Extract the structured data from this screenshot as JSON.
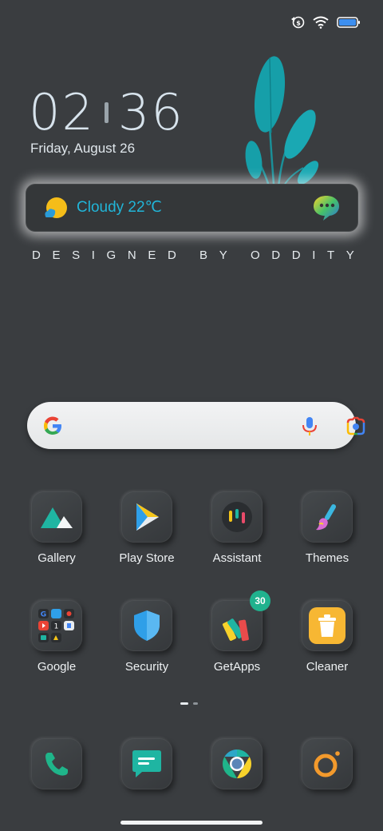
{
  "status": {
    "icons": [
      "data-saver-icon",
      "wifi-icon",
      "battery-icon"
    ]
  },
  "clock": {
    "hours": "02",
    "minutes": "36"
  },
  "date": "Friday, August 26",
  "weather": {
    "text": "Cloudy 22℃",
    "icon": "partly-cloudy-icon"
  },
  "tagline": [
    "D",
    "E",
    "S",
    "I",
    "G",
    "N",
    "E",
    "D",
    " ",
    "B",
    "Y",
    " ",
    "O",
    "D",
    "D",
    "I",
    "T",
    "Y"
  ],
  "search": {
    "icon": "google-g-icon",
    "mic_icon": "mic-icon",
    "lens_icon": "lens-icon"
  },
  "apps": [
    {
      "label": "Gallery",
      "icon": "gallery-icon"
    },
    {
      "label": "Play Store",
      "icon": "play-store-icon"
    },
    {
      "label": "Assistant",
      "icon": "assistant-icon"
    },
    {
      "label": "Themes",
      "icon": "themes-icon"
    },
    {
      "label": "Google",
      "icon": "google-folder-icon"
    },
    {
      "label": "Security",
      "icon": "security-icon"
    },
    {
      "label": "GetApps",
      "icon": "getapps-icon",
      "badge": "30"
    },
    {
      "label": "Cleaner",
      "icon": "cleaner-icon"
    }
  ],
  "dock": [
    {
      "icon": "phone-icon"
    },
    {
      "icon": "messages-icon"
    },
    {
      "icon": "chrome-icon"
    },
    {
      "icon": "camera-icon"
    }
  ],
  "colors": {
    "background": "#3a3d40",
    "accent": "#1fb5a2",
    "weather_text": "#21b5d8"
  }
}
